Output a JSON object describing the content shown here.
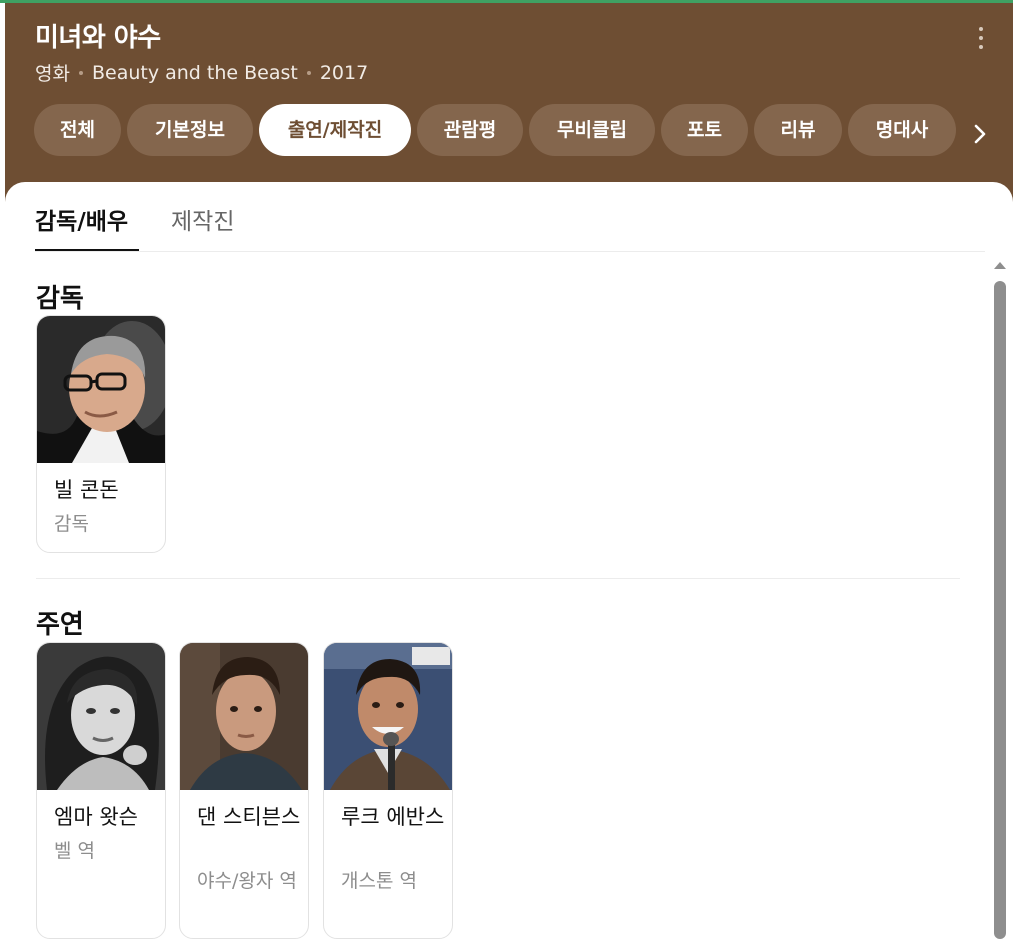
{
  "header": {
    "title": "미녀와 야수",
    "category": "영화",
    "original_title": "Beauty and the Beast",
    "year": "2017",
    "background_color": "#6e4e33"
  },
  "tabs": [
    {
      "label": "전체",
      "active": false
    },
    {
      "label": "기본정보",
      "active": false
    },
    {
      "label": "출연/제작진",
      "active": true
    },
    {
      "label": "관람평",
      "active": false
    },
    {
      "label": "무비클립",
      "active": false
    },
    {
      "label": "포토",
      "active": false
    },
    {
      "label": "리뷰",
      "active": false
    },
    {
      "label": "명대사",
      "active": false
    }
  ],
  "icons": {
    "more": "more-vertical-icon",
    "next": "chevron-right-icon",
    "scroll_up": "scroll-up-arrow-icon"
  },
  "subtabs": [
    {
      "label": "감독/배우",
      "active": true
    },
    {
      "label": "제작진",
      "active": false
    }
  ],
  "sections": [
    {
      "title": "감독",
      "people": [
        {
          "name": "빌 콘돈",
          "role": "감독"
        }
      ]
    },
    {
      "title": "주연",
      "people": [
        {
          "name": "엠마 왓슨",
          "role": "벨 역"
        },
        {
          "name": "댄 스티븐스",
          "role": "야수/왕자 역"
        },
        {
          "name": "루크 에반스",
          "role": "개스톤 역"
        }
      ]
    }
  ]
}
